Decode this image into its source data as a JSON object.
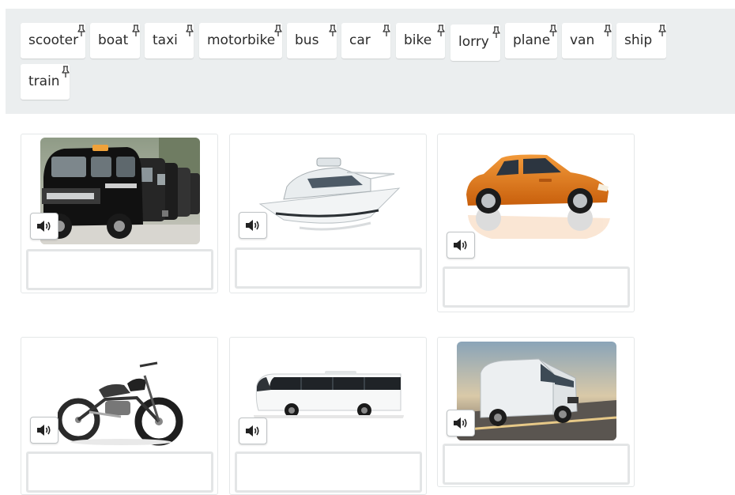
{
  "word_bank": {
    "words": [
      "scooter",
      "boat",
      "taxi",
      "motorbike",
      "bus",
      "car",
      "bike",
      "lorry",
      "plane",
      "van",
      "ship",
      "train"
    ],
    "pin_icon": "pin-icon"
  },
  "cards": [
    {
      "picture": "taxi-image",
      "audio_icon": "speaker-icon",
      "answer": ""
    },
    {
      "picture": "boat-image",
      "audio_icon": "speaker-icon",
      "answer": ""
    },
    {
      "picture": "car-image",
      "audio_icon": "speaker-icon",
      "answer": ""
    },
    {
      "picture": "motorbike-image",
      "audio_icon": "speaker-icon",
      "answer": ""
    },
    {
      "picture": "bus-image",
      "audio_icon": "speaker-icon",
      "answer": ""
    },
    {
      "picture": "van-image",
      "audio_icon": "speaker-icon",
      "answer": ""
    }
  ],
  "colors": {
    "bank_background": "#ebeeef",
    "chip_background": "#ffffff",
    "drop_border": "#e3e5e6",
    "car_orange": "#e87a18"
  }
}
